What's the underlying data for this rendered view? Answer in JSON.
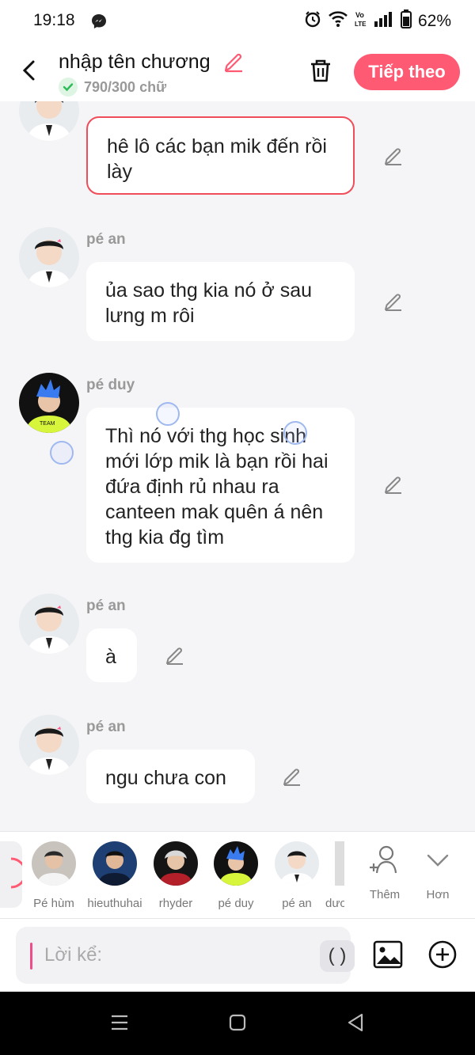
{
  "status_bar": {
    "time": "19:18",
    "battery": "62%",
    "icons": [
      "messenger-icon",
      "alarm-icon",
      "wifi-icon",
      "volte-icon",
      "signal-icon",
      "battery-icon"
    ]
  },
  "header": {
    "title": "nhập tên chương",
    "word_count": "790/300 chữ",
    "next_button": "Tiếp theo"
  },
  "messages": [
    {
      "name": "",
      "text": "hê lô các bạn mik đến rồi lày",
      "selected": true
    },
    {
      "name": "pé an",
      "text": "ủa sao thg kia nó ở sau lưng m rôi",
      "selected": false
    },
    {
      "name": "pé duy",
      "text": "Thì nó với thg học sinh mới lớp mik là bạn  rồi hai đứa định rủ nhau ra canteen mak quên á nên thg kia đg tìm",
      "selected": false
    },
    {
      "name": "pé an",
      "text": "à",
      "selected": false
    },
    {
      "name": "pé an",
      "text": "ngu chưa con",
      "selected": false
    }
  ],
  "characters": [
    {
      "label": "Pé hùm"
    },
    {
      "label": "hieuthuhai"
    },
    {
      "label": "rhyder"
    },
    {
      "label": "pé duy"
    },
    {
      "label": "pé an"
    },
    {
      "label": "dươ"
    }
  ],
  "strip_buttons": {
    "add": "Thêm",
    "more": "Hơn"
  },
  "input": {
    "placeholder": "Lời kể:",
    "paren_button": "( )"
  },
  "colors": {
    "accent": "#ff5a73",
    "selected_border": "#f04c5a",
    "background": "#f5f5f7"
  }
}
